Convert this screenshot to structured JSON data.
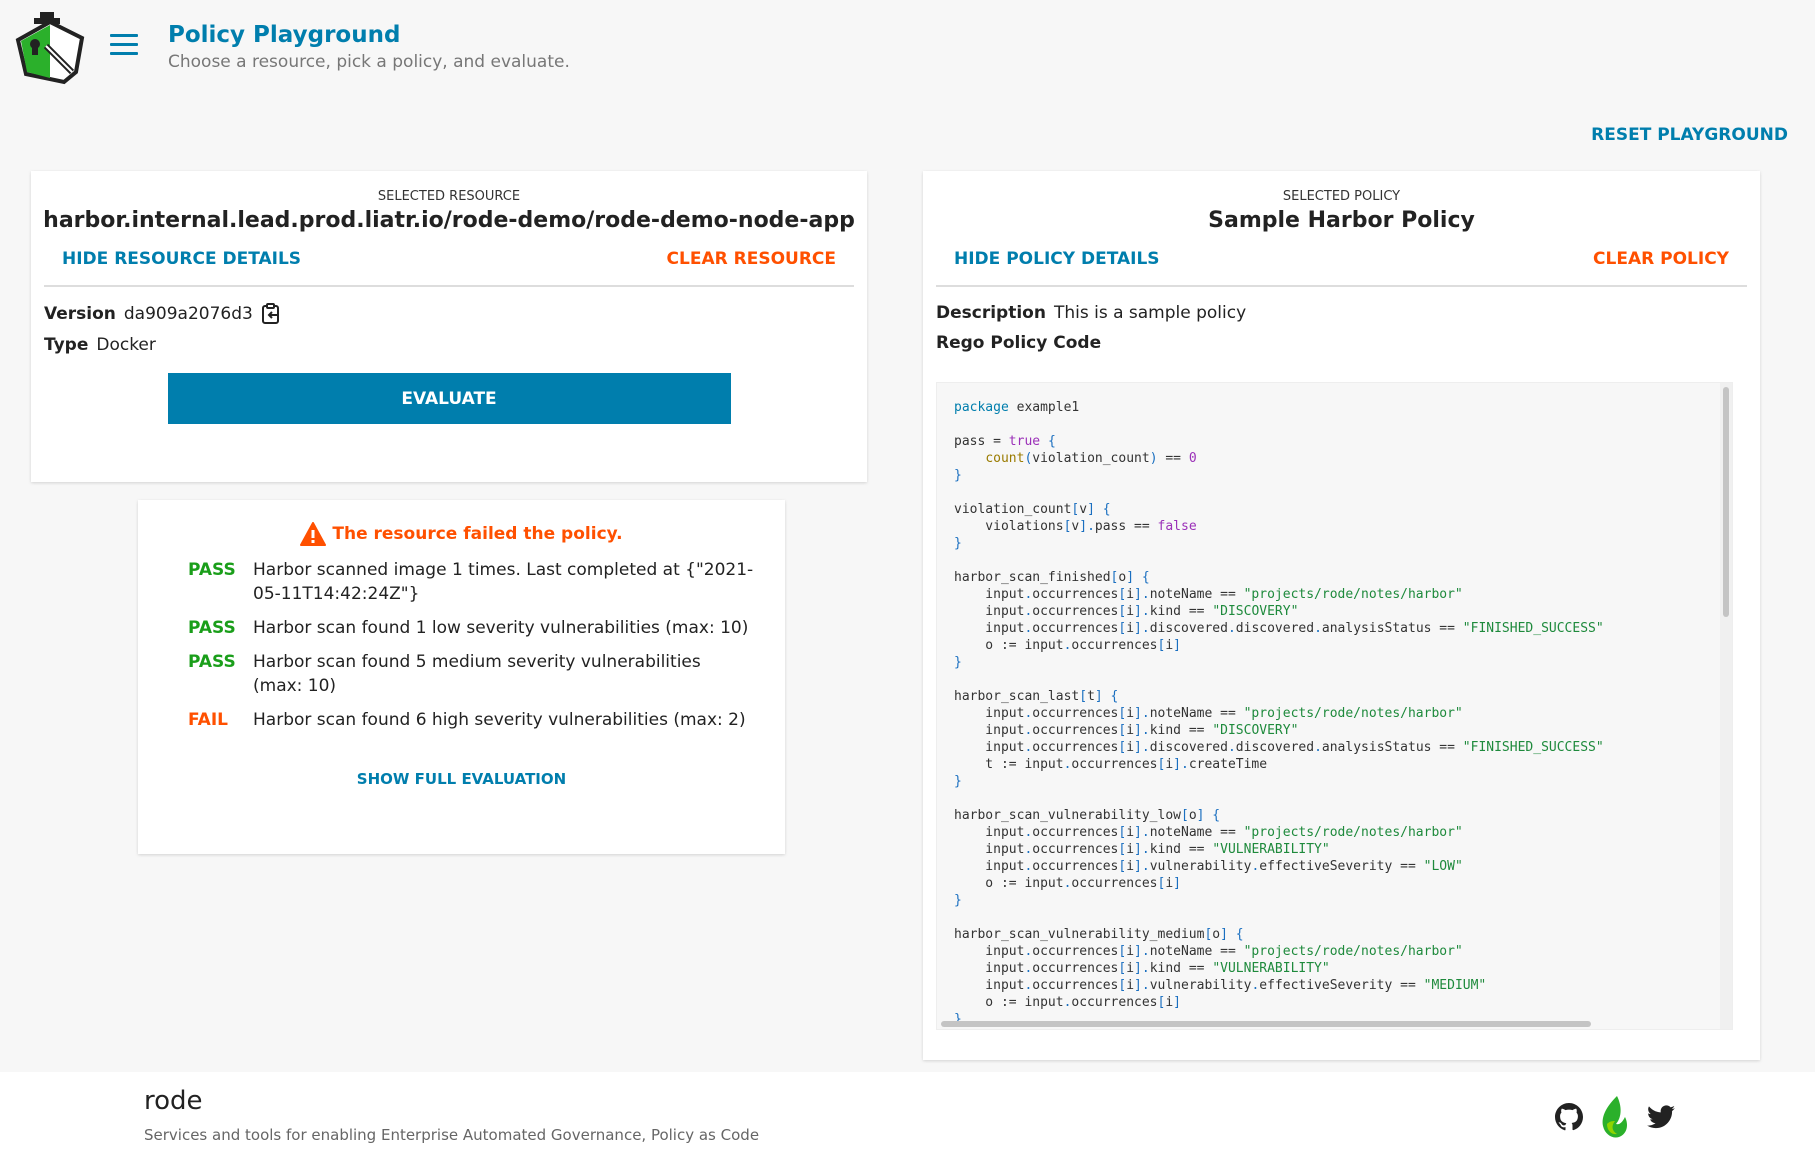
{
  "header": {
    "title": "Policy Playground",
    "subtitle": "Choose a resource, pick a policy, and evaluate.",
    "reset": "RESET PLAYGROUND"
  },
  "resource": {
    "label": "SELECTED RESOURCE",
    "name": "harbor.internal.lead.prod.liatr.io/rode-demo/rode-demo-node-app",
    "hide": "HIDE RESOURCE DETAILS",
    "clear": "CLEAR RESOURCE",
    "version_label": "Version",
    "version": "da909a2076d3",
    "type_label": "Type",
    "type": "Docker",
    "evaluate": "EVALUATE"
  },
  "result": {
    "message": "The resource failed the policy.",
    "items": [
      {
        "status": "PASS",
        "text": "Harbor scanned image 1 times. Last completed at {\"2021-05-11T14:42:24Z\"}"
      },
      {
        "status": "PASS",
        "text": "Harbor scan found 1 low severity vulnerabilities (max: 10)"
      },
      {
        "status": "PASS",
        "text": "Harbor scan found 5 medium severity vulnerabilities (max: 10)"
      },
      {
        "status": "FAIL",
        "text": "Harbor scan found 6 high severity vulnerabilities (max: 2)"
      }
    ],
    "show_full": "SHOW FULL EVALUATION"
  },
  "policy": {
    "label": "SELECTED POLICY",
    "name": "Sample Harbor Policy",
    "hide": "HIDE POLICY DETAILS",
    "clear": "CLEAR POLICY",
    "desc_label": "Description",
    "desc": "This is a sample policy",
    "code_label": "Rego Policy Code",
    "code": [
      "package example1",
      "",
      "pass = true {",
      "    count(violation_count) == 0",
      "}",
      "",
      "violation_count[v] {",
      "    violations[v].pass == false",
      "}",
      "",
      "harbor_scan_finished[o] {",
      "    input.occurrences[i].noteName == \"projects/rode/notes/harbor\"",
      "    input.occurrences[i].kind == \"DISCOVERY\"",
      "    input.occurrences[i].discovered.discovered.analysisStatus == \"FINISHED_SUCCESS\"",
      "    o := input.occurrences[i]",
      "}",
      "",
      "harbor_scan_last[t] {",
      "    input.occurrences[i].noteName == \"projects/rode/notes/harbor\"",
      "    input.occurrences[i].kind == \"DISCOVERY\"",
      "    input.occurrences[i].discovered.discovered.analysisStatus == \"FINISHED_SUCCESS\"",
      "    t := input.occurrences[i].createTime",
      "}",
      "",
      "harbor_scan_vulnerability_low[o] {",
      "    input.occurrences[i].noteName == \"projects/rode/notes/harbor\"",
      "    input.occurrences[i].kind == \"VULNERABILITY\"",
      "    input.occurrences[i].vulnerability.effectiveSeverity == \"LOW\"",
      "    o := input.occurrences[i]",
      "}",
      "",
      "harbor_scan_vulnerability_medium[o] {",
      "    input.occurrences[i].noteName == \"projects/rode/notes/harbor\"",
      "    input.occurrences[i].kind == \"VULNERABILITY\"",
      "    input.occurrences[i].vulnerability.effectiveSeverity == \"MEDIUM\"",
      "    o := input.occurrences[i]",
      "}"
    ]
  },
  "footer": {
    "brand": "rode",
    "tagline": "Services and tools for enabling Enterprise Automated Governance, Policy as Code",
    "icons": [
      "github-icon",
      "rode-flame-icon",
      "twitter-icon"
    ]
  },
  "colors": {
    "accent": "#007ead",
    "danger": "#ff5000",
    "pass": "#1a9e1a"
  }
}
